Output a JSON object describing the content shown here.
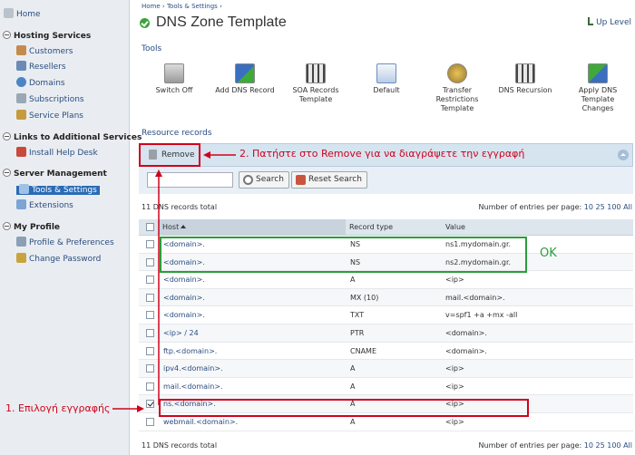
{
  "sidebar": {
    "home": "Home",
    "groups": [
      {
        "title": "Hosting Services",
        "items": [
          "Customers",
          "Resellers",
          "Domains",
          "Subscriptions",
          "Service Plans"
        ]
      },
      {
        "title": "Links to Additional Services",
        "items": [
          "Install Help Desk"
        ]
      },
      {
        "title": "Server Management",
        "items": [
          "Tools & Settings",
          "Extensions"
        ]
      },
      {
        "title": "My Profile",
        "items": [
          "Profile & Preferences",
          "Change Password"
        ]
      }
    ],
    "selected_item": "Tools & Settings"
  },
  "breadcrumb": [
    "Home",
    "Tools & Settings"
  ],
  "breadcrumb_sep": "›",
  "page_title": "DNS Zone Template",
  "up_level": "Up Level",
  "tools_heading": "Tools",
  "tools": [
    {
      "label": "Switch Off",
      "icon": "switch-off-icon"
    },
    {
      "label": "Add DNS Record",
      "icon": "add-dns-record-icon"
    },
    {
      "label": "SOA Records Template",
      "icon": "soa-records-icon"
    },
    {
      "label": "Default",
      "icon": "default-icon"
    },
    {
      "label": "Transfer Restrictions Template",
      "icon": "transfer-restrictions-icon"
    },
    {
      "label": "DNS Recursion",
      "icon": "dns-recursion-icon"
    },
    {
      "label": "Apply DNS Template Changes",
      "icon": "apply-dns-icon"
    }
  ],
  "resource_records_heading": "Resource records",
  "toolbar": {
    "remove_label": "Remove"
  },
  "filter": {
    "search_placeholder": "",
    "search_label": "Search",
    "reset_label": "Reset Search"
  },
  "total_top": "11 DNS records total",
  "total_bottom": "11 DNS records total",
  "entries_per_page_label": "Number of entries per page:",
  "entries_per_page_options": [
    "10",
    "25",
    "100",
    "All"
  ],
  "table": {
    "columns": [
      "Host",
      "Record type",
      "Value"
    ],
    "rows": [
      {
        "host": "<domain>.",
        "type": "NS",
        "value": "ns1.mydomain.gr.",
        "checked": false
      },
      {
        "host": "<domain>.",
        "type": "NS",
        "value": "ns2.mydomain.gr.",
        "checked": false
      },
      {
        "host": "<domain>.",
        "type": "A",
        "value": "<ip>",
        "checked": false
      },
      {
        "host": "<domain>.",
        "type": "MX (10)",
        "value": "mail.<domain>.",
        "checked": false
      },
      {
        "host": "<domain>.",
        "type": "TXT",
        "value": "v=spf1 +a +mx -all",
        "checked": false
      },
      {
        "host": "<ip> / 24",
        "type": "PTR",
        "value": "<domain>.",
        "checked": false
      },
      {
        "host": "ftp.<domain>.",
        "type": "CNAME",
        "value": "<domain>.",
        "checked": false
      },
      {
        "host": "ipv4.<domain>.",
        "type": "A",
        "value": "<ip>",
        "checked": false
      },
      {
        "host": "mail.<domain>.",
        "type": "A",
        "value": "<ip>",
        "checked": false
      },
      {
        "host": "ns.<domain>.",
        "type": "A",
        "value": "<ip>",
        "checked": true
      },
      {
        "host": "webmail.<domain>.",
        "type": "A",
        "value": "<ip>",
        "checked": false
      }
    ]
  },
  "annotations": {
    "step1": "1. Επιλογή εγγραφής",
    "step2": "2. Πατήστε στο Remove για να διαγράψετε την εγγραφή",
    "ok": "OK"
  },
  "colors": {
    "accent": "#2a4d80",
    "annotation_red": "#d0021b",
    "annotation_green": "#2a9d3a",
    "selected_nav": "#2a6bb5"
  }
}
